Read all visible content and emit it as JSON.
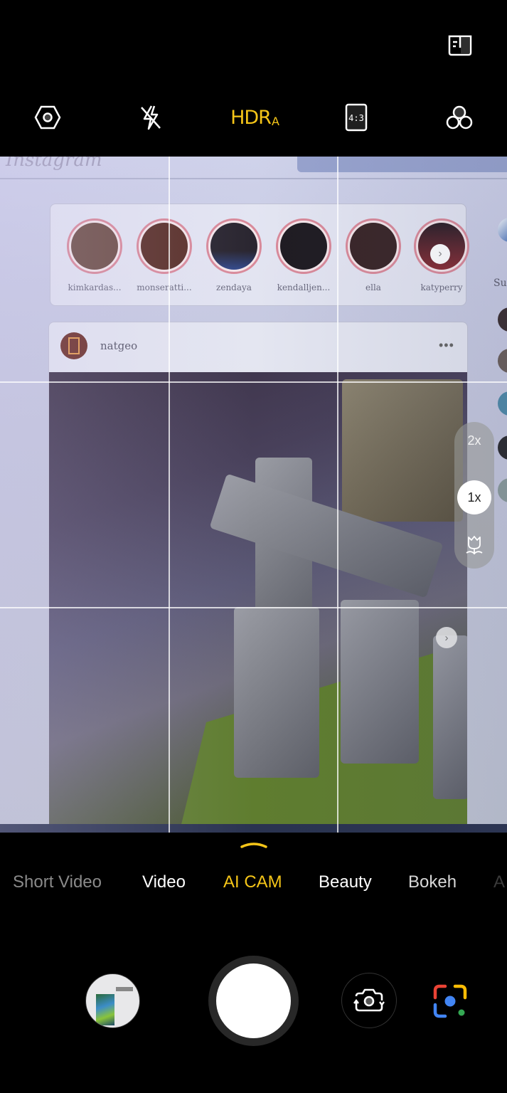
{
  "top_bar": {
    "ai_guide_icon": "book-icon",
    "settings_icon": "settings-hexagon-icon",
    "flash_icon": "flash-off-icon",
    "hdr_label": "HDR",
    "hdr_mode": "A",
    "hdr_color": "#f5c518",
    "aspect_ratio_label": "4:3",
    "filter_icon": "filter-circles-icon"
  },
  "viewfinder": {
    "grid": "3x3",
    "scene": {
      "app_logo_text": "Instagram",
      "stories": [
        {
          "name": "kimkardas..."
        },
        {
          "name": "monseratti..."
        },
        {
          "name": "zendaya"
        },
        {
          "name": "kendalljen..."
        },
        {
          "name": "ella"
        },
        {
          "name": "katyperry"
        }
      ],
      "right_strip_text": "Su",
      "post": {
        "username": "natgeo",
        "more_label": "•••",
        "next_label": "›"
      },
      "story_next_label": "›"
    }
  },
  "zoom_control": {
    "options": [
      "2x",
      "1x"
    ],
    "selected": "1x",
    "macro_icon": "tulip-macro-icon"
  },
  "modes": {
    "items": [
      {
        "label": "Short Video",
        "state": "dim"
      },
      {
        "label": "Video",
        "state": "normal"
      },
      {
        "label": "AI CAM",
        "state": "active"
      },
      {
        "label": "Beauty",
        "state": "normal"
      },
      {
        "label": "Bokeh",
        "state": "dim"
      },
      {
        "label": "A",
        "state": "faint"
      }
    ],
    "active_color": "#f5c518"
  },
  "bottom": {
    "gallery_icon": "gallery-thumbnail",
    "shutter_icon": "shutter-button",
    "switch_camera_icon": "switch-camera-icon",
    "lens_icon": "google-lens-icon"
  }
}
